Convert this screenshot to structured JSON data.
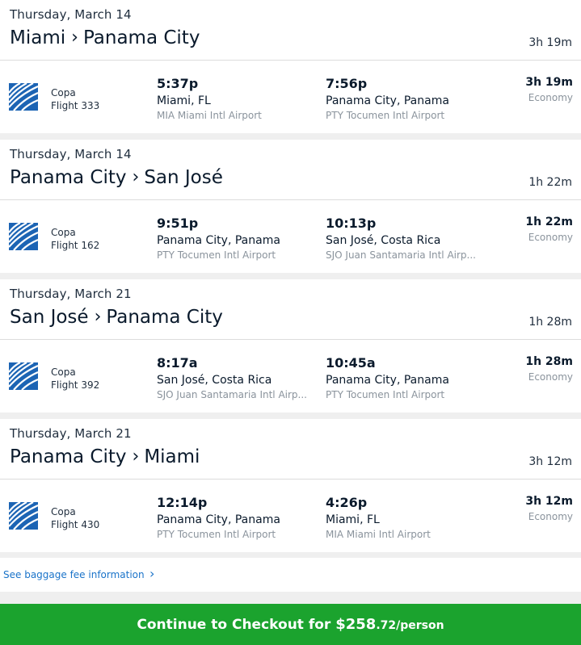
{
  "segments": [
    {
      "date": "Thursday, March 14",
      "origin": "Miami",
      "destination": "Panama City",
      "duration": "3h 19m",
      "airline": "Copa",
      "flight": "Flight 333",
      "dep_time": "5:37p",
      "dep_city": "Miami, FL",
      "dep_airport": "MIA Miami Intl Airport",
      "arr_time": "7:56p",
      "arr_city": "Panama City, Panama",
      "arr_airport": "PTY Tocumen Intl Airport",
      "cabin": "Economy"
    },
    {
      "date": "Thursday, March 14",
      "origin": "Panama City",
      "destination": "San José",
      "duration": "1h 22m",
      "airline": "Copa",
      "flight": "Flight 162",
      "dep_time": "9:51p",
      "dep_city": "Panama City, Panama",
      "dep_airport": "PTY Tocumen Intl Airport",
      "arr_time": "10:13p",
      "arr_city": "San José, Costa Rica",
      "arr_airport": "SJO Juan Santamaria Intl Airp...",
      "cabin": "Economy"
    },
    {
      "date": "Thursday, March 21",
      "origin": "San José",
      "destination": "Panama City",
      "duration": "1h 28m",
      "airline": "Copa",
      "flight": "Flight 392",
      "dep_time": "8:17a",
      "dep_city": "San José, Costa Rica",
      "dep_airport": "SJO Juan Santamaria Intl Airp...",
      "arr_time": "10:45a",
      "arr_city": "Panama City, Panama",
      "arr_airport": "PTY Tocumen Intl Airport",
      "cabin": "Economy"
    },
    {
      "date": "Thursday, March 21",
      "origin": "Panama City",
      "destination": "Miami",
      "duration": "3h 12m",
      "airline": "Copa",
      "flight": "Flight 430",
      "dep_time": "12:14p",
      "dep_city": "Panama City, Panama",
      "dep_airport": "PTY Tocumen Intl Airport",
      "arr_time": "4:26p",
      "arr_city": "Miami, FL",
      "arr_airport": "MIA Miami Intl Airport",
      "cabin": "Economy"
    }
  ],
  "route_separator": "›",
  "baggage": {
    "label": "See baggage fee information",
    "chevron": "›"
  },
  "checkout": {
    "prefix": "Continue to Checkout for ",
    "price_main": "$258",
    "price_cents": ".72",
    "per": "/person"
  },
  "colors": {
    "cta_green": "#1ba32e",
    "link_blue": "#1a73c9",
    "copa_blue": "#1c64b4",
    "page_bg": "#efefef"
  },
  "icons": {
    "airline_logo": "copa-logo-icon",
    "link_chevron": "chevron-right-icon"
  }
}
